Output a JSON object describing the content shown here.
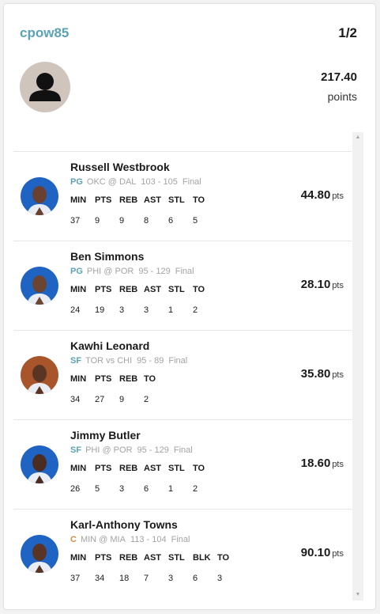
{
  "header": {
    "username": "cpow85",
    "rank": "1/2",
    "total_points": "217.40",
    "points_label": "points"
  },
  "colors": {
    "accent": "#5aa3b4",
    "center_pos": "#d98c4a"
  },
  "players": [
    {
      "name": "Russell Westbrook",
      "pos": "PG",
      "matchup": "OKC @ DAL",
      "score": "103 - 105",
      "status": "Final",
      "headers": [
        "MIN",
        "PTS",
        "REB",
        "AST",
        "STL",
        "TO"
      ],
      "values": [
        "37",
        "9",
        "9",
        "8",
        "6",
        "5"
      ],
      "points": "44.80",
      "unit": "pts",
      "jersey": "#1f64c3",
      "skin": "#6a4030"
    },
    {
      "name": "Ben Simmons",
      "pos": "PG",
      "matchup": "PHI @ POR",
      "score": "95 - 129",
      "status": "Final",
      "headers": [
        "MIN",
        "PTS",
        "REB",
        "AST",
        "STL",
        "TO"
      ],
      "values": [
        "24",
        "19",
        "3",
        "3",
        "1",
        "2"
      ],
      "points": "28.10",
      "unit": "pts",
      "jersey": "#1f64c3",
      "skin": "#6b4532"
    },
    {
      "name": "Kawhi Leonard",
      "pos": "SF",
      "matchup": "TOR vs CHI",
      "score": "95 - 89",
      "status": "Final",
      "headers": [
        "MIN",
        "PTS",
        "REB",
        "TO"
      ],
      "values": [
        "34",
        "27",
        "9",
        "2"
      ],
      "points": "35.80",
      "unit": "pts",
      "jersey": "#a9552b",
      "skin": "#5b3524"
    },
    {
      "name": "Jimmy Butler",
      "pos": "SF",
      "matchup": "PHI @ POR",
      "score": "95 - 129",
      "status": "Final",
      "headers": [
        "MIN",
        "PTS",
        "REB",
        "AST",
        "STL",
        "TO"
      ],
      "values": [
        "26",
        "5",
        "3",
        "6",
        "1",
        "2"
      ],
      "points": "18.60",
      "unit": "pts",
      "jersey": "#1f64c3",
      "skin": "#4a2c20"
    },
    {
      "name": "Karl-Anthony Towns",
      "pos": "C",
      "matchup": "MIN @ MIA",
      "score": "113 - 104",
      "status": "Final",
      "headers": [
        "MIN",
        "PTS",
        "REB",
        "AST",
        "STL",
        "BLK",
        "TO"
      ],
      "values": [
        "37",
        "34",
        "18",
        "7",
        "3",
        "6",
        "3"
      ],
      "points": "90.10",
      "unit": "pts",
      "jersey": "#1f64c3",
      "skin": "#5a3526"
    }
  ],
  "icons": {
    "avatar": "user-silhouette-icon",
    "scroll_up": "arrow-up-icon",
    "scroll_down": "arrow-down-icon"
  }
}
